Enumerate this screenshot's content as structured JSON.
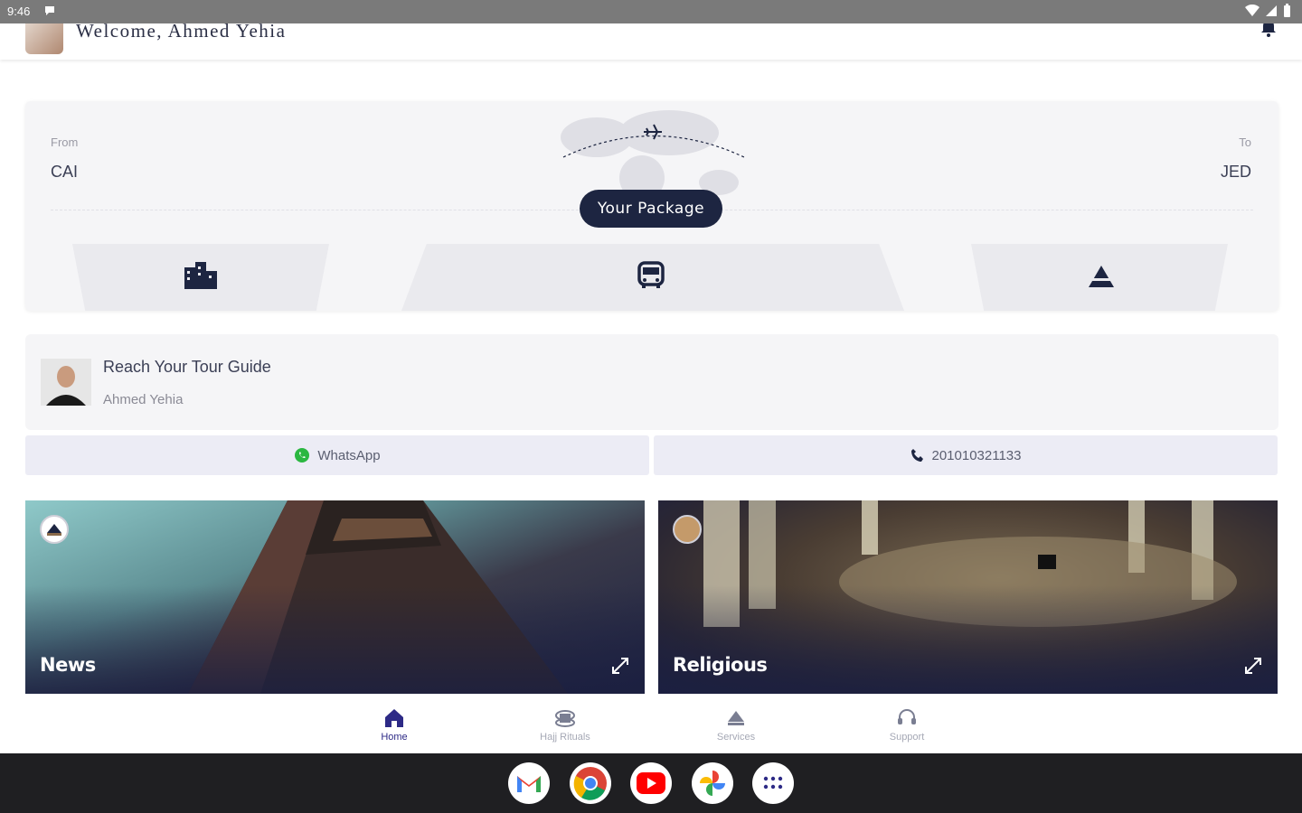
{
  "status_bar": {
    "time": "9:46"
  },
  "header": {
    "welcome": "Welcome, Ahmed Yehia"
  },
  "flight": {
    "from_label": "From",
    "from_code": "CAI",
    "to_label": "To",
    "to_code": "JED",
    "package_button": "Your Package"
  },
  "guide": {
    "title": "Reach Your Tour Guide",
    "name": "Ahmed Yehia",
    "whatsapp_label": "WhatsApp",
    "phone": "201010321133"
  },
  "cards": [
    {
      "label": "News"
    },
    {
      "label": "Religious"
    }
  ],
  "nav": {
    "items": [
      {
        "label": "Home",
        "icon": "home-icon",
        "active": true
      },
      {
        "label": "Hajj Rituals",
        "icon": "rituals-icon",
        "active": false
      },
      {
        "label": "Services",
        "icon": "services-icon",
        "active": false
      },
      {
        "label": "Support",
        "icon": "support-icon",
        "active": false
      }
    ]
  },
  "dock": {
    "apps": [
      "gmail-icon",
      "chrome-icon",
      "youtube-icon",
      "photos-icon",
      "apps-grid-icon"
    ]
  },
  "colors": {
    "primary_navy": "#1d2541",
    "nav_active": "#2d2a86",
    "card_bg": "#f5f5f7",
    "button_bg": "#ececf5"
  }
}
